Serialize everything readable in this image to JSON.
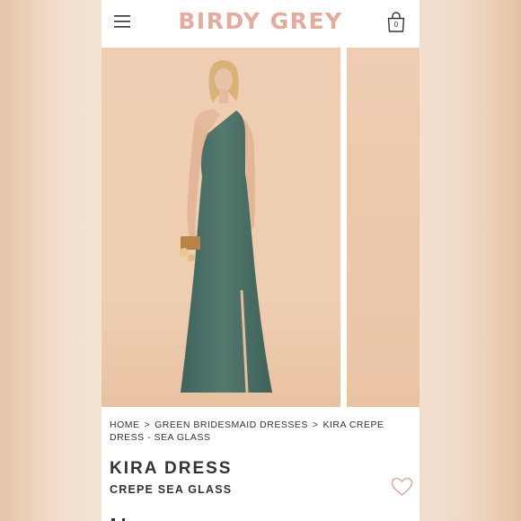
{
  "header": {
    "brand": "BIRDY GREY",
    "menu_icon": "hamburger-icon",
    "bag_icon": "shopping-bag-icon",
    "bag_count": "0",
    "brand_color": "#e4ab9f"
  },
  "gallery": {
    "dress_color": "#4f756d",
    "backdrop_color": "#efcdb2"
  },
  "breadcrumb": {
    "items": [
      "HOME",
      "GREEN BRIDESMAID DRESSES",
      "KIRA CREPE DRESS - SEA GLASS"
    ],
    "separator": ">"
  },
  "product": {
    "name": "KIRA DRESS",
    "variant": "CREPE SEA GLASS",
    "favorite_icon": "heart-icon",
    "favorite_color": "#e4ab9f"
  }
}
